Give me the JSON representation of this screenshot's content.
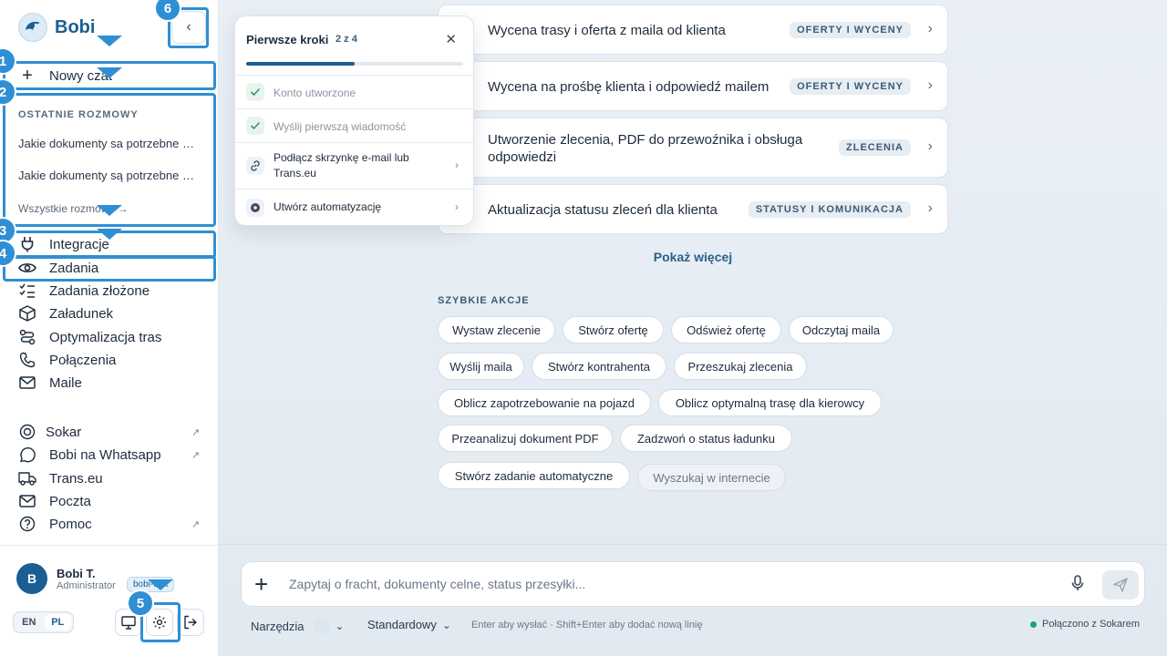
{
  "app": {
    "name": "Bobi",
    "collapse_icon": "chevron-left-icon"
  },
  "sidebar": {
    "new_chat": "Nowy czat",
    "recent_label": "OSTATNIE ROZMOWY",
    "recent": [
      "Jakie dokumenty sa potrzebne do odprawy",
      "Jakie dokumenty są potrzebne do odprawy"
    ],
    "all_conversations": "Wszystkie rozmowy",
    "nav": [
      {
        "label": "Integracje",
        "icon": "plug-icon"
      },
      {
        "label": "Zadania",
        "icon": "eye-icon"
      },
      {
        "label": "Zadania złożone",
        "icon": "checklist-icon"
      },
      {
        "label": "Załadunek",
        "icon": "box-icon"
      },
      {
        "label": "Optymalizacja tras",
        "icon": "route-icon"
      },
      {
        "label": "Połączenia",
        "icon": "phone-icon"
      },
      {
        "label": "Maile",
        "icon": "mail-icon"
      }
    ],
    "links": [
      {
        "label": "Sokar",
        "icon": "sokar-icon",
        "external": "↗"
      },
      {
        "label": "Bobi na Whatsapp",
        "icon": "whatsapp-icon",
        "external": "↗"
      },
      {
        "label": "Trans.eu",
        "icon": "truck-icon",
        "external": ""
      },
      {
        "label": "Poczta",
        "icon": "mail-icon",
        "external": ""
      },
      {
        "label": "Pomoc",
        "icon": "help-icon",
        "external": "↗"
      }
    ],
    "user": {
      "initial": "B",
      "name": "Bobi T.",
      "role": "Administrator",
      "badge": "bobi-test"
    },
    "languages": [
      "EN",
      "PL"
    ],
    "active_language": "PL"
  },
  "tour": {
    "steps": [
      "1",
      "2",
      "3",
      "4",
      "5",
      "6"
    ],
    "color": "#2f8fd4"
  },
  "popover": {
    "title": "Pierwsze kroki",
    "count": "2 z 4",
    "progress": 0.5,
    "steps": [
      {
        "label": "Konto utworzone",
        "done": true,
        "icon": "check-icon"
      },
      {
        "label": "Wyślij pierwszą wiadomość",
        "done": true,
        "icon": "check-icon"
      },
      {
        "label": "Podłącz skrzynkę e-mail lub Trans.eu",
        "done": false,
        "icon": "link-icon"
      },
      {
        "label": "Utwórz automatyzację",
        "done": false,
        "icon": "gear-icon"
      }
    ]
  },
  "tasks": [
    {
      "title": "Wycena trasy i oferta z maila od klienta",
      "tag": "OFERTY I WYCENY"
    },
    {
      "title": "Wycena na prośbę klienta i odpowiedź mailem",
      "tag": "OFERTY I WYCENY"
    },
    {
      "title": "Utworzenie zlecenia, PDF do przewoźnika i obsługa odpowiedzi",
      "tag": "ZLECENIA"
    },
    {
      "title": "Aktualizacja statusu zleceń dla klienta",
      "tag": "STATUSY I KOMUNIKACJA"
    }
  ],
  "show_more": "Pokaż więcej",
  "quick_actions": {
    "label": "SZYBKIE AKCJE",
    "chips": [
      "Wystaw zlecenie",
      "Stwórz ofertę",
      "Odśwież ofertę",
      "Odczytaj maila",
      "Wyślij maila",
      "Stwórz kontrahenta",
      "Przeszukaj zlecenia",
      "Oblicz zapotrzebowanie na pojazd",
      "Oblicz optymalną trasę dla kierowcy",
      "Przeanalizuj dokument PDF",
      "Zadzwoń o status ładunku",
      "Stwórz zadanie automatyczne",
      "Wyszukaj w internecie"
    ]
  },
  "composer": {
    "placeholder": "Zapytaj o fracht, dokumenty celne, status przesyłki...",
    "tools_label": "Narzędzia",
    "mode_label": "Standardowy",
    "hint": "Enter aby wysłać · Shift+Enter aby dodać nową linię",
    "status": "Połączono z Sokarem",
    "status_color": "#1aa36b"
  }
}
